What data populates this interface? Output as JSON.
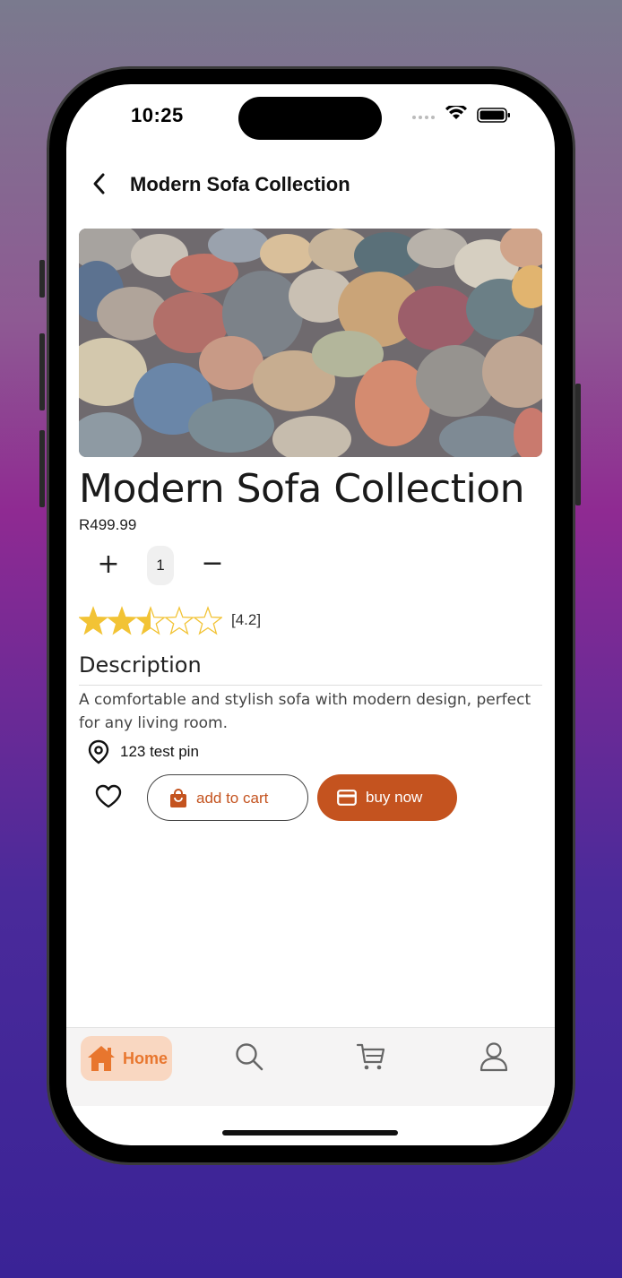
{
  "status_bar": {
    "time": "10:25"
  },
  "header": {
    "title": "Modern Sofa Collection"
  },
  "product": {
    "title": "Modern Sofa Collection",
    "price": "R499.99",
    "quantity": "1",
    "plus_label": "+",
    "minus_label": "−",
    "rating_stars": 2.5,
    "rating_max": 5,
    "rating_label": "[4.2]",
    "description_heading": "Description",
    "description": "A comfortable and stylish sofa with modern design, perfect for any living room.",
    "location": "123 test pin"
  },
  "actions": {
    "add_to_cart": "add to cart",
    "buy_now": "buy now"
  },
  "tabs": [
    {
      "label": "Home",
      "icon": "home-icon",
      "active": true
    },
    {
      "label": "",
      "icon": "search-icon"
    },
    {
      "label": "",
      "icon": "cart-icon"
    },
    {
      "label": "",
      "icon": "profile-icon"
    }
  ],
  "colors": {
    "accent": "#c4531f",
    "tab_active_bg": "#f9d7c1",
    "tab_active_fg": "#e8762e",
    "star": "#f2c335"
  }
}
